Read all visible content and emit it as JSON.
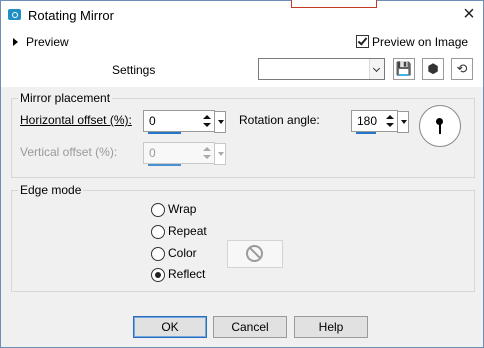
{
  "window": {
    "title": "Rotating Mirror",
    "close_icon": "close-icon"
  },
  "top": {
    "preview_label": "Preview",
    "preview_on_image_label": "Preview on Image",
    "preview_on_image_checked": true,
    "settings_label": "Settings",
    "settings_value": "",
    "icons": [
      "save-icon",
      "cube-icon",
      "reset-icon"
    ]
  },
  "mirror_placement": {
    "title": "Mirror placement",
    "horizontal_label": "Horizontal offset (%):",
    "horizontal_value": "0",
    "rotation_label": "Rotation angle:",
    "rotation_value": "180",
    "vertical_label": "Vertical offset (%):",
    "vertical_value": "0"
  },
  "edge_mode": {
    "title": "Edge mode",
    "options": [
      "Wrap",
      "Repeat",
      "Color",
      "Reflect"
    ],
    "selected": "Reflect"
  },
  "buttons": {
    "ok": "OK",
    "cancel": "Cancel",
    "help": "Help"
  },
  "colors": {
    "accent": "#2377c8",
    "title_bar": "#ffffff",
    "background": "#f0f0f0"
  }
}
